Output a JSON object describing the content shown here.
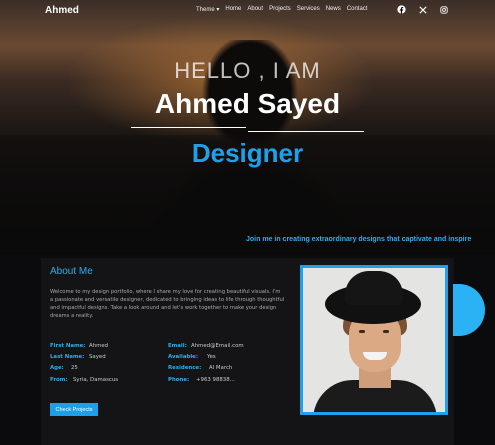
{
  "nav": {
    "brand": "Ahmed",
    "menu": [
      "Theme ▾",
      "Home",
      "About",
      "Projects",
      "Services",
      "News",
      "Contact"
    ],
    "social_icons": [
      "facebook-icon",
      "x-icon",
      "instagram-icon"
    ]
  },
  "hero": {
    "greeting": "HELLO , I AM",
    "name": "Ahmed Sayed",
    "role": "Designer",
    "tagline": "Join me in creating extraordinary designs that captivate and inspire"
  },
  "about": {
    "title": "About Me",
    "description": "Welcome to my design portfolio, where I share my love for creating beautiful visuals. I'm a passionate and versatile designer, dedicated to bringing ideas to life through thoughtful and impactful designs. Take a look around and let's work together to make your design dreams a reality.",
    "left_info": [
      {
        "key": "First Name:",
        "value": "Ahmed"
      },
      {
        "key": "Last Name:",
        "value": "Sayed"
      },
      {
        "key": "Age:",
        "value": "25"
      },
      {
        "key": "From:",
        "value": "Syria, Damascus"
      }
    ],
    "right_info": [
      {
        "key": "Email:",
        "value": "Ahmed@Email.com"
      },
      {
        "key": "Available:",
        "value": "Yes"
      },
      {
        "key": "Residence:",
        "value": "Al March"
      },
      {
        "key": "Phone:",
        "value": "+963 98838..."
      }
    ],
    "button": "Check Projects"
  },
  "colors": {
    "accent": "#1ea0ea",
    "background": "#0b0b0d",
    "card": "#141416"
  }
}
